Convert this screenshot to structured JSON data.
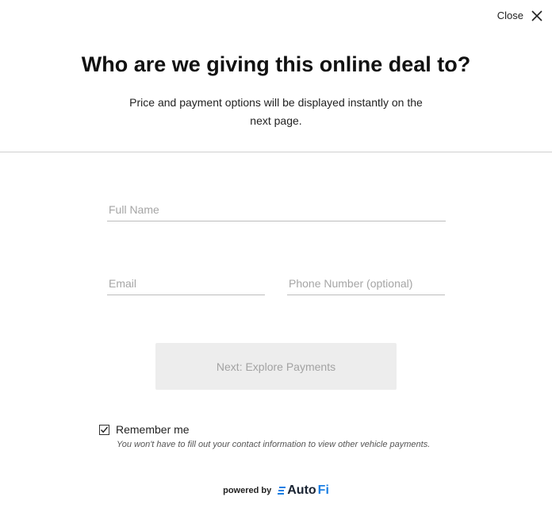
{
  "header": {
    "close_label": "Close",
    "title": "Who are we giving this online deal to?",
    "subtitle": "Price and payment options will be displayed instantly on the next page."
  },
  "form": {
    "full_name": {
      "placeholder": "Full Name",
      "value": ""
    },
    "email": {
      "placeholder": "Email",
      "value": ""
    },
    "phone": {
      "placeholder": "Phone Number (optional)",
      "value": ""
    },
    "submit_label": "Next: Explore Payments",
    "remember": {
      "label": "Remember me",
      "checked": true,
      "note": "You won't have to fill out your contact information to view other vehicle payments."
    }
  },
  "footer": {
    "powered_by": "powered by",
    "brand_auto": "Auto",
    "brand_fi": "Fi"
  },
  "icons": {
    "close": "close-icon",
    "checkbox": "checkmark-icon",
    "logo": "autofi-logo-icon"
  },
  "colors": {
    "brand_dark": "#1a2433",
    "brand_blue": "#1b7fe3",
    "button_disabled_bg": "#ededed",
    "button_disabled_text": "#a2a2a2"
  }
}
